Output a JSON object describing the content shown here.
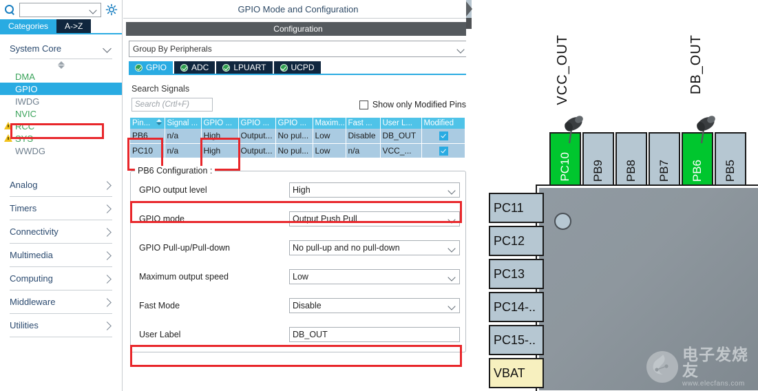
{
  "sidebar": {
    "search": {
      "value": "",
      "icon": "search-icon"
    },
    "settings_icon": "gear-icon",
    "tabs": [
      {
        "label": "Categories",
        "active": true
      },
      {
        "label": "A->Z",
        "active": false
      }
    ],
    "system_core": {
      "title": "System Core",
      "peripherals": [
        {
          "label": "DMA",
          "state": "green",
          "warn": false,
          "selected": false
        },
        {
          "label": "GPIO",
          "state": "green",
          "warn": false,
          "selected": true
        },
        {
          "label": "IWDG",
          "state": "gray",
          "warn": false,
          "selected": false
        },
        {
          "label": "NVIC",
          "state": "green",
          "warn": false,
          "selected": false
        },
        {
          "label": "RCC",
          "state": "green",
          "warn": true,
          "selected": false
        },
        {
          "label": "SYS",
          "state": "green",
          "warn": true,
          "selected": false
        },
        {
          "label": "WWDG",
          "state": "gray",
          "warn": false,
          "selected": false
        }
      ]
    },
    "categories": [
      {
        "label": "Analog"
      },
      {
        "label": "Timers"
      },
      {
        "label": "Connectivity"
      },
      {
        "label": "Multimedia"
      },
      {
        "label": "Computing"
      },
      {
        "label": "Middleware"
      },
      {
        "label": "Utilities"
      }
    ]
  },
  "center": {
    "mode_title": "GPIO Mode and Configuration",
    "configuration_title": "Configuration",
    "group_by": {
      "value": "Group By Peripherals"
    },
    "peripheral_tabs": [
      {
        "label": "GPIO",
        "ok": true,
        "active": true
      },
      {
        "label": "ADC",
        "ok": true,
        "active": false
      },
      {
        "label": "LPUART",
        "ok": true,
        "active": false
      },
      {
        "label": "UCPD",
        "ok": true,
        "active": false
      }
    ],
    "search_signals": {
      "label": "Search Signals",
      "placeholder": "Search (Crtl+F)",
      "value": ""
    },
    "show_modified": {
      "label": "Show only Modified Pins",
      "checked": false
    },
    "table": {
      "headers": [
        "Pin...",
        "Signal ...",
        "GPIO ...",
        "GPIO ...",
        "GPIO ...",
        "Maxim...",
        "Fast ...",
        "User L...",
        "Modified"
      ],
      "sorted_column_index": 0,
      "rows": [
        {
          "pin": "PB6",
          "signal": "n/a",
          "output_level": "High",
          "mode": "Output...",
          "pull": "No pul...",
          "speed": "Low",
          "fast": "Disable",
          "user_label": "DB_OUT",
          "modified": true
        },
        {
          "pin": "PC10",
          "signal": "n/a",
          "output_level": "High",
          "mode": "Output...",
          "pull": "No pul...",
          "speed": "Low",
          "fast": "n/a",
          "user_label": "VCC_...",
          "modified": true
        }
      ]
    },
    "pin_config": {
      "legend": "PB6 Configuration :",
      "fields": [
        {
          "label": "GPIO output level",
          "value": "High",
          "type": "combo",
          "highlighted": true
        },
        {
          "label": "GPIO mode",
          "value": "Output Push Pull",
          "type": "combo",
          "highlighted": false
        },
        {
          "label": "GPIO Pull-up/Pull-down",
          "value": "No pull-up and no pull-down",
          "type": "combo",
          "highlighted": false
        },
        {
          "label": "Maximum output speed",
          "value": "Low",
          "type": "combo",
          "highlighted": false
        },
        {
          "label": "Fast Mode",
          "value": "Disable",
          "type": "combo",
          "highlighted": false
        },
        {
          "label": "User Label",
          "value": "DB_OUT",
          "type": "text",
          "highlighted": true
        }
      ]
    }
  },
  "chip": {
    "top_pins": [
      {
        "name": "PC10",
        "configured": true,
        "label": "VCC_OUT",
        "pinned": true
      },
      {
        "name": "PB9",
        "configured": false,
        "label": "",
        "pinned": false
      },
      {
        "name": "PB8",
        "configured": false,
        "label": "",
        "pinned": false
      },
      {
        "name": "PB7",
        "configured": false,
        "label": "",
        "pinned": false
      },
      {
        "name": "PB6",
        "configured": true,
        "label": "DB_OUT",
        "pinned": true
      },
      {
        "name": "PB5",
        "configured": false,
        "label": "",
        "pinned": false
      }
    ],
    "left_pins": [
      {
        "name": "PC11",
        "type": "io"
      },
      {
        "name": "PC12",
        "type": "io"
      },
      {
        "name": "PC13",
        "type": "io"
      },
      {
        "name": "PC14-..",
        "type": "io"
      },
      {
        "name": "PC15-..",
        "type": "io"
      },
      {
        "name": "VBAT",
        "type": "power"
      }
    ],
    "watermark": {
      "cn": "电子发烧友",
      "url": "www.elecfans.com"
    }
  },
  "colors": {
    "accent_cyan": "#29ABE2",
    "tab_dark": "#10263e",
    "table_header": "#4FC3E8",
    "table_row": "#aacbe2",
    "highlight_red": "#e8262a",
    "pin_configured": "#00c62e",
    "pin_default": "#b6c7d2",
    "pin_power": "#f7f0bf",
    "ok_green": "#2f9e4f",
    "warn_yellow": "#f2c21a"
  }
}
